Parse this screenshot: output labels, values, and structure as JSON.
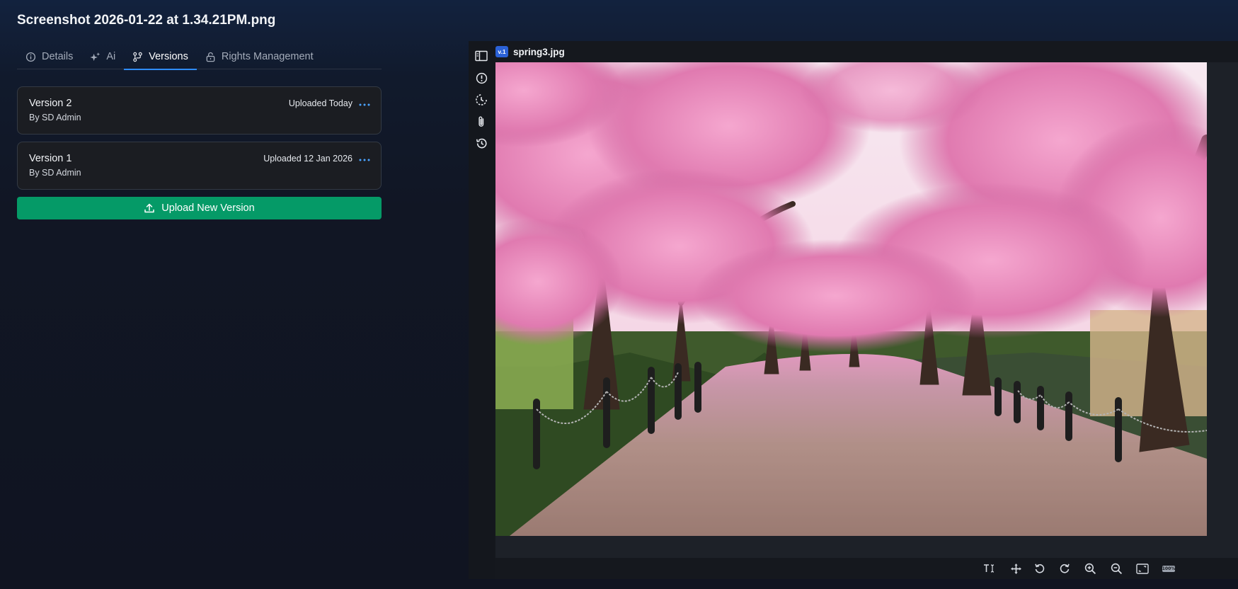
{
  "window": {
    "title": "Screenshot 2026-01-22 at 1.34.21PM.png"
  },
  "tabs": [
    {
      "label": "Details",
      "icon": "info-icon"
    },
    {
      "label": "Ai",
      "icon": "sparkle-icon"
    },
    {
      "label": "Versions",
      "icon": "versions-icon",
      "active": true
    },
    {
      "label": "Rights Management",
      "icon": "lock-icon"
    }
  ],
  "versions": [
    {
      "name": "Version 2",
      "author": "By SD Admin",
      "uploaded": "Uploaded Today"
    },
    {
      "name": "Version 1",
      "author": "By SD Admin",
      "uploaded": "Uploaded 12 Jan 2026"
    }
  ],
  "upload_button": {
    "label": "Upload New Version",
    "color": "#059a67"
  },
  "viewer": {
    "version_badge": "v.1",
    "file_name": "spring3.jpg",
    "side_icons": [
      "panel-toggle-icon",
      "info-icon",
      "clock-icon",
      "attachment-icon",
      "history-icon"
    ],
    "toolbar_icons": [
      "text-select-icon",
      "move-icon",
      "rotate-left-icon",
      "rotate-right-icon",
      "zoom-in-icon",
      "zoom-out-icon",
      "fit-screen-icon",
      "actual-size-icon"
    ],
    "zoom_label": "100%"
  },
  "colors": {
    "accent": "#2f8cff",
    "background": "#111624",
    "card": "#1b1d22"
  }
}
